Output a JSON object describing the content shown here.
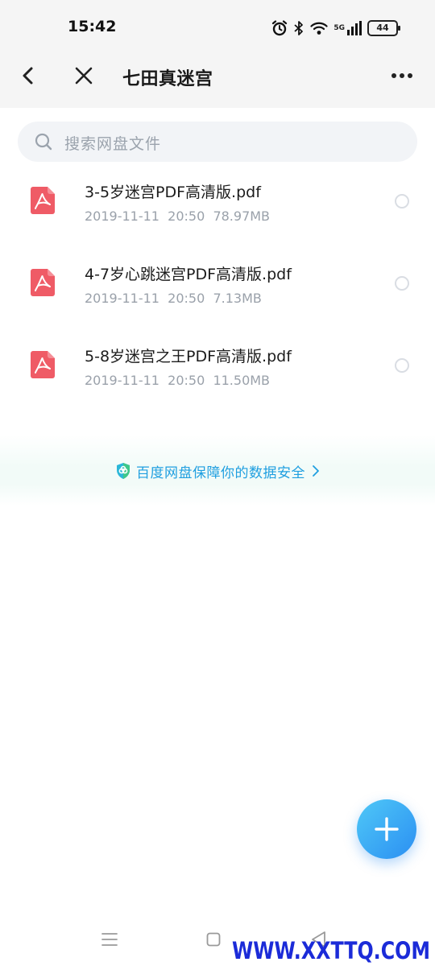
{
  "status_bar": {
    "time": "15:42",
    "network": "5G",
    "battery": "44"
  },
  "header": {
    "title": "七田真迷宫"
  },
  "search": {
    "placeholder": "搜索网盘文件"
  },
  "files": [
    {
      "name": "3-5岁迷宫PDF高清版.pdf",
      "date": "2019-11-11",
      "time": "20:50",
      "size": "78.97MB"
    },
    {
      "name": "4-7岁心跳迷宫PDF高清版.pdf",
      "date": "2019-11-11",
      "time": "20:50",
      "size": "7.13MB"
    },
    {
      "name": "5-8岁迷宫之王PDF高清版.pdf",
      "date": "2019-11-11",
      "time": "20:50",
      "size": "11.50MB"
    }
  ],
  "security_banner": {
    "text": "百度网盘保障你的数据安全"
  },
  "watermark": "WWW.XXTTQ.COM",
  "colors": {
    "accent": "#2b8ff2",
    "pdf_icon": "#ef5b66",
    "security_text": "#1f9fe0",
    "watermark": "#1b2bd8"
  },
  "icons": {
    "back": "chevron-left-icon",
    "close": "close-icon",
    "more": "more-icon",
    "search": "search-icon",
    "file": "pdf-icon",
    "shield": "shield-icon",
    "add": "plus-icon"
  }
}
